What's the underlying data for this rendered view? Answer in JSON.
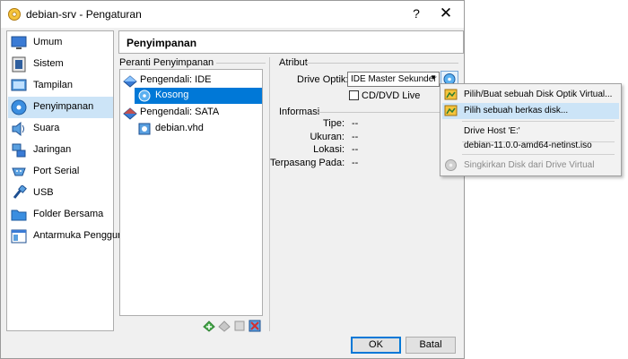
{
  "window": {
    "title": "debian-srv - Pengaturan",
    "help": "?",
    "close": "✕"
  },
  "sidebar": {
    "items": [
      {
        "label": "Umum",
        "icon": "monitor-general-icon"
      },
      {
        "label": "Sistem",
        "icon": "chip-icon"
      },
      {
        "label": "Tampilan",
        "icon": "display-icon"
      },
      {
        "label": "Penyimpanan",
        "icon": "storage-disk-icon",
        "active": true
      },
      {
        "label": "Suara",
        "icon": "speaker-icon"
      },
      {
        "label": "Jaringan",
        "icon": "network-icon"
      },
      {
        "label": "Port Serial",
        "icon": "serial-port-icon"
      },
      {
        "label": "USB",
        "icon": "usb-icon"
      },
      {
        "label": "Folder Bersama",
        "icon": "shared-folder-icon"
      },
      {
        "label": "Antarmuka Pengguna",
        "icon": "user-interface-icon"
      }
    ]
  },
  "page": {
    "title": "Penyimpanan"
  },
  "storage": {
    "group_label": "Peranti Penyimpanan",
    "tree": {
      "controller_ide": "Pengendali: IDE",
      "ide_item": "Kosong",
      "controller_sata": "Pengendali: SATA",
      "sata_item": "debian.vhd"
    }
  },
  "attributes": {
    "group_label": "Atribut",
    "optical_drive_label": "Drive Optik:",
    "optical_drive_value": "IDE Master Sekunder",
    "live_cd_label": "CD/DVD Live",
    "live_cd_checked": false
  },
  "info": {
    "group_label": "Informasi",
    "rows": [
      {
        "label": "Tipe:",
        "value": "--"
      },
      {
        "label": "Ukuran:",
        "value": "--"
      },
      {
        "label": "Lokasi:",
        "value": "--"
      },
      {
        "label": "Terpasang Pada:",
        "value": "--"
      }
    ]
  },
  "buttons": {
    "ok": "OK",
    "cancel": "Batal"
  },
  "menu": {
    "items": [
      {
        "label": "Pilih/Buat sebuah Disk Optik Virtual...",
        "icon": "optical-disk-create-icon"
      },
      {
        "label": "Pilih sebuah berkas disk...",
        "icon": "choose-disk-file-icon",
        "highlighted": true
      },
      {
        "label": "Drive Host 'E:'"
      },
      {
        "label": "debian-11.0.0-amd64-netinst.iso"
      },
      {
        "label": "Singkirkan Disk dari Drive Virtual",
        "icon": "remove-disk-icon",
        "disabled": true
      }
    ]
  },
  "colors": {
    "selection": "#0078d7",
    "hover": "#cce4f7"
  }
}
